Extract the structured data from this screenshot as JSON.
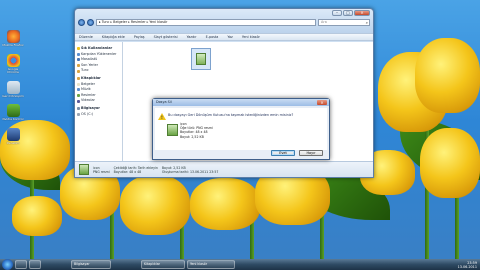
{
  "desktop": {
    "icons": [
      {
        "label": "Mozilla Firefox",
        "color": "#e8661e"
      },
      {
        "label": "Google Chrome",
        "color": "#3d8ee0"
      },
      {
        "label": "Geri Dönüşüm",
        "color": "#9fb6c8"
      },
      {
        "label": "Nvidia Kontrol",
        "color": "#3f7a3a"
      },
      {
        "label": "Denetim",
        "color": "#2a4f8e"
      }
    ]
  },
  "explorer": {
    "breadcrumb": [
      "Tunc",
      "Belgeler",
      "Resimler",
      "Yeni klasör"
    ],
    "search_placeholder": "Ara",
    "commands": [
      "Düzenle",
      "Kitaplığa ekle",
      "Paylaş",
      "Slayt gösterisi",
      "Yazdır",
      "E-posta",
      "Yaz",
      "Yeni klasör"
    ],
    "nav": [
      {
        "label": "Sık Kullanılanlar",
        "head": true
      },
      {
        "label": "Karşıdan Yüklenenler",
        "head": false
      },
      {
        "label": "Masaüstü",
        "head": false
      },
      {
        "label": "Son Yerler",
        "head": false
      },
      {
        "label": "Tunc",
        "head": false
      },
      {
        "label": "Kitaplıklar",
        "head": true
      },
      {
        "label": "Belgeler",
        "head": false
      },
      {
        "label": "Müzik",
        "head": false
      },
      {
        "label": "Resimler",
        "head": false
      },
      {
        "label": "Videolar",
        "head": false
      },
      {
        "label": "Bilgisayar",
        "head": true
      },
      {
        "label": "OS (C:)",
        "head": false
      }
    ],
    "details": {
      "name": "icon",
      "type": "PNG resmi",
      "taken_label": "Çekildiği tarih:",
      "taken_value": "Tarih ekleyin",
      "dim_label": "Boyutlar:",
      "dim_value": "48 x 48",
      "size_label": "Boyut:",
      "size_value": "2,52 KB",
      "created_label": "Oluşturma tarihi:",
      "created_value": "13.06.2011 23:57"
    }
  },
  "dialog": {
    "title": "Dosya Sil",
    "question": "Bu dosyayı Geri Dönüşüm Kutusu'na taşımak istediğinizden emin misiniz?",
    "file": {
      "name": "icon",
      "type": "Öğe türü: PNG resmi",
      "dimensions": "Boyutlar: 48 x 48",
      "size": "Boyut: 2,52 KB"
    },
    "yes": "Evet",
    "no": "Hayır"
  },
  "taskbar": {
    "items": [
      "Bilgisayar",
      "Kitaplıklar",
      "Yeni klasör"
    ],
    "time": "23:59",
    "date": "13.06.2011"
  }
}
